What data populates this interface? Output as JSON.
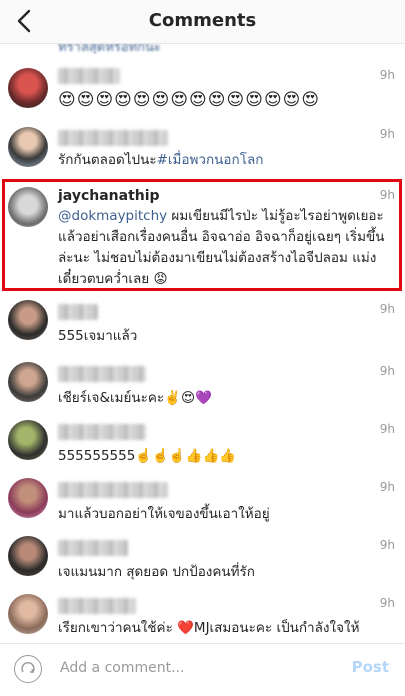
{
  "header": {
    "title": "Comments",
    "back_icon": "back-arrow-icon"
  },
  "comments": [
    {
      "username": "",
      "time": "9h",
      "text": "😍😍😍😍😍😍😍😍😍😍😍😍😍😍"
    },
    {
      "username": "",
      "time": "9h",
      "text_plain": "รักกันตลอดไปนะ",
      "hashtag": "#เมื่อพวกนอกโลก"
    },
    {
      "username": "jaychanathip",
      "time": "9h",
      "mention": "@dokmaypitchy",
      "text": " ผมเขียนมีไรป่ะ ไม่รู้อะไรอย่าพูดเยอะ แล้วอย่าเสือกเรื่องคนอื่น อิจฉาอ่อ อิจฉาก็อยู่เฉยๆ เริ่มขึ้นล่ะนะ ไม่ชอบไม่ต้องมาเขียนไม่ต้องสร้างไอจีปลอม แม่งเดี๋ยวตบคว่ำเลย 😡"
    },
    {
      "username": "",
      "time": "9h",
      "text": "555เจมาแล้ว"
    },
    {
      "username": "",
      "time": "9h",
      "text": "เชียร์เจ&เมย์นะคะ✌️😍💜"
    },
    {
      "username": "",
      "time": "9h",
      "text": "555555555☝️☝️☝️👍👍👍"
    },
    {
      "username": "",
      "time": "9h",
      "text": "มาแล้วบอกอย่าให้เจของขึ้นเอาให้อยู่"
    },
    {
      "username": "",
      "time": "9h",
      "text": "เจแมนมาก สุดยอด ปกป้องคนที่รัก"
    },
    {
      "username": "",
      "time": "9h",
      "text": "เรียกเขาว่าคนใช้ค่ะ ❤️MJเสมอนะคะ เป็นกำลังใจให้"
    }
  ],
  "footer": {
    "placeholder": "Add a comment...",
    "post_label": "Post",
    "camera_icon": "camera-icon"
  }
}
